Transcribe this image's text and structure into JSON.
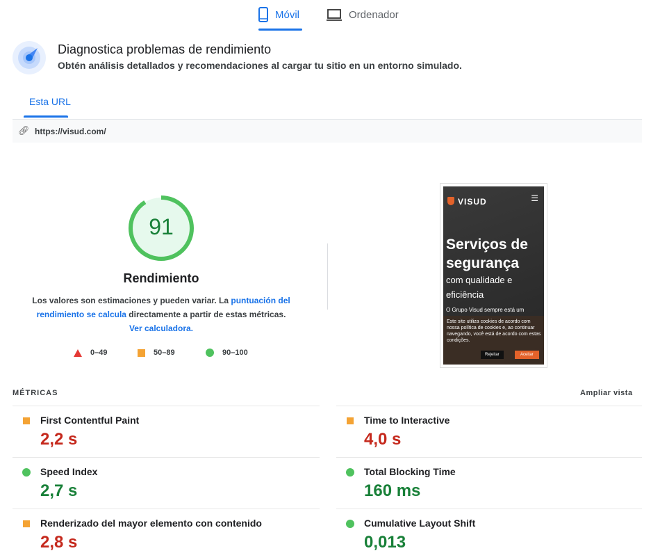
{
  "device_tabs": [
    {
      "label": "Móvil",
      "active": true
    },
    {
      "label": "Ordenador",
      "active": false
    }
  ],
  "header": {
    "title": "Diagnostica problemas de rendimiento",
    "subtitle": "Obtén análisis detallados y recomendaciones al cargar tu sitio en un entorno simulado."
  },
  "url_tab": "Esta URL",
  "url": "https://visud.com/",
  "score": {
    "value": "91",
    "fraction": 0.91,
    "label": "Rendimiento",
    "desc_1": "Los valores son estimaciones y pueden variar. La ",
    "link_1": "puntuación del rendimiento se calcula",
    "desc_2": " directamente a partir de estas métricas. ",
    "link_2": "Ver calculadora.",
    "legend": [
      "0–49",
      "50–89",
      "90–100"
    ]
  },
  "preview": {
    "brand": "VISUD",
    "headline": "Serviços de segurança",
    "sub": "com qualidade e eficiência",
    "body": "O Grupo Visud sempre está um",
    "cookie": "Este site utiliza cookies de acordo com nossa política de cookies e, ao continuar navegando, você está de acordo com estas condições.",
    "reject": "Rejeitar",
    "accept": "Aceitar"
  },
  "metrics": {
    "title": "MÉTRICAS",
    "expand": "Ampliar vista",
    "items": [
      {
        "label": "First Contentful Paint",
        "value": "2,2 s"
      },
      {
        "label": "Time to Interactive",
        "value": "4,0 s"
      },
      {
        "label": "Speed Index",
        "value": "2,7 s"
      },
      {
        "label": "Total Blocking Time",
        "value": "160 ms"
      },
      {
        "label": "Renderizado del mayor elemento con contenido",
        "value": "2,8 s"
      },
      {
        "label": "Cumulative Layout Shift",
        "value": "0,013"
      }
    ]
  },
  "colors": {
    "accent": "#1a73e8",
    "pass": "#0cce6b",
    "average": "#ffa400",
    "fail": "#ff4e42"
  }
}
